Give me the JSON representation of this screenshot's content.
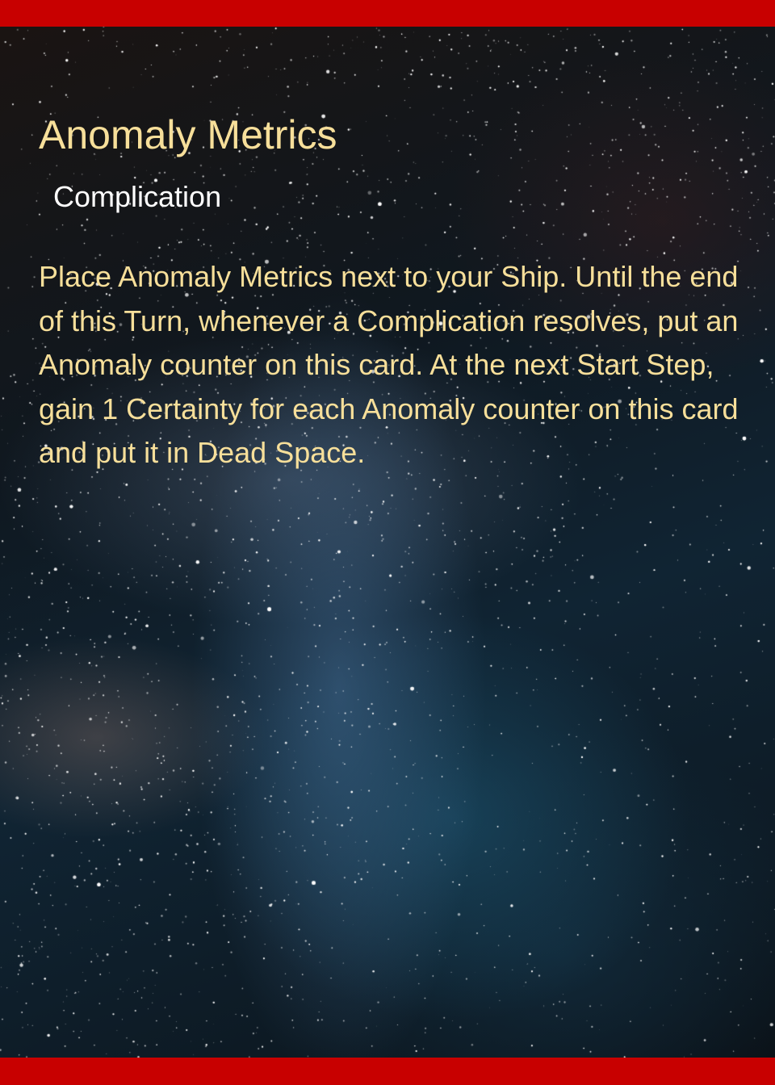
{
  "card": {
    "name": "Anomaly Metrics",
    "type": "Complication",
    "rules_text": "Place Anomaly Metrics next to your Ship. Until the end of this Turn, whenever a Complication resolves, put an Anomaly counter on this card. At the next Start Step, gain 1 Certainty for each Anomaly counter on this card and put it in Dead Space."
  },
  "colors": {
    "border": "#c80000",
    "title_text": "#f7df9a",
    "type_text": "#ffffff",
    "rules_text": "#f7df9a"
  },
  "background": {
    "image": "starry-night-sky"
  }
}
